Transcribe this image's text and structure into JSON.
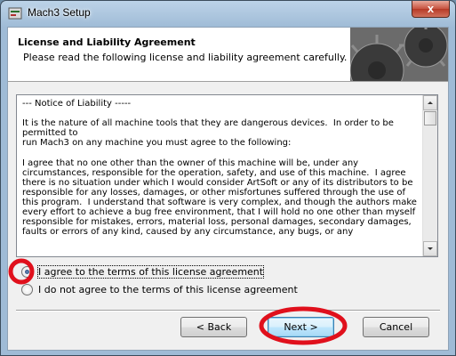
{
  "window": {
    "title": "Mach3 Setup",
    "close_glyph": "x"
  },
  "header": {
    "title": "License and Liability Agreement",
    "subtitle": "Please read the following license and liability agreement carefully.",
    "graphic": "gears-image"
  },
  "license": {
    "text": "--- Notice of Liability -----\n\nIt is the nature of all machine tools that they are dangerous devices.  In order to be permitted to\nrun Mach3 on any machine you must agree to the following:\n\nI agree that no one other than the owner of this machine will be, under any circumstances, responsible for the operation, safety, and use of this machine.  I agree there is no situation under which I would consider ArtSoft or any of its distributors to be responsible for any losses, damages, or other misfortunes suffered through the use of this program.  I understand that software is very complex, and though the authors make every effort to achieve a bug free environment, that I will hold no one other than myself responsible for mistakes, errors, material loss, personal damages, secondary damages, faults or errors of any kind, caused by any circumstance, any bugs, or any"
  },
  "options": [
    {
      "label": "I agree to the terms of this license agreement",
      "checked": true
    },
    {
      "label": "I do not agree to the terms of this license agreement",
      "checked": false
    }
  ],
  "buttons": {
    "back": "< Back",
    "next": "Next >",
    "cancel": "Cancel"
  },
  "colors": {
    "annotation": "#e0101c",
    "accent": "#3c7fb1"
  },
  "icons": [
    "app-icon",
    "close-icon",
    "scroll-up-icon",
    "scroll-down-icon"
  ]
}
